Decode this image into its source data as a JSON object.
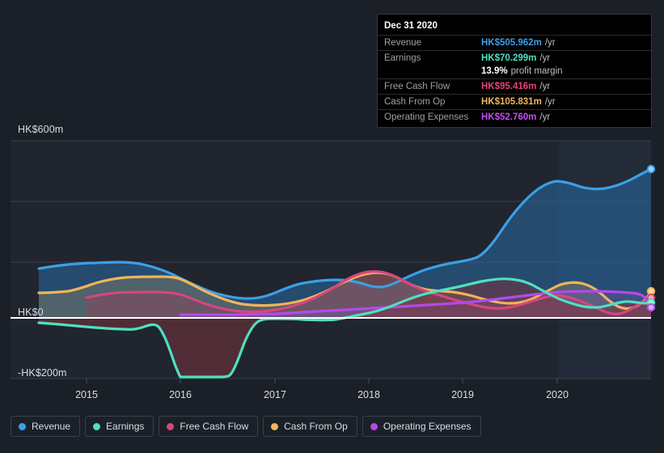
{
  "tooltip": {
    "title": "Dec 31 2020",
    "rows": [
      {
        "label": "Revenue",
        "value": "HK$505.962m",
        "unit": "/yr",
        "color": "#3b9fe8"
      },
      {
        "label": "Earnings",
        "value": "HK$70.299m",
        "unit": "/yr",
        "color": "#4fe0c0"
      },
      {
        "label": "",
        "value": "13.9%",
        "unit": "profit margin",
        "color": "#ffffff"
      },
      {
        "label": "Free Cash Flow",
        "value": "HK$95.416m",
        "unit": "/yr",
        "color": "#e8417e"
      },
      {
        "label": "Cash From Op",
        "value": "HK$105.831m",
        "unit": "/yr",
        "color": "#f0b45a"
      },
      {
        "label": "Operating Expenses",
        "value": "HK$52.760m",
        "unit": "/yr",
        "color": "#c14ef0"
      }
    ]
  },
  "legend": {
    "items": [
      {
        "label": "Revenue",
        "color": "#3b9fe8"
      },
      {
        "label": "Earnings",
        "color": "#4fe0c0"
      },
      {
        "label": "Free Cash Flow",
        "color": "#d6467e"
      },
      {
        "label": "Cash From Op",
        "color": "#f0b45a"
      },
      {
        "label": "Operating Expenses",
        "color": "#b44ae8"
      }
    ]
  },
  "axes": {
    "y_labels": [
      {
        "text": "HK$600m"
      },
      {
        "text": "HK$0"
      },
      {
        "text": "-HK$200m"
      }
    ],
    "x_labels": [
      {
        "text": "2015"
      },
      {
        "text": "2016"
      },
      {
        "text": "2017"
      },
      {
        "text": "2018"
      },
      {
        "text": "2019"
      },
      {
        "text": "2020"
      }
    ]
  },
  "chart_data": {
    "type": "area",
    "title": "",
    "xlabel": "",
    "ylabel": "HK$m",
    "currency": "HK$",
    "unit": "m",
    "ylim": [
      -260,
      600
    ],
    "yticks": [
      600,
      0,
      -200
    ],
    "ytick_labels": [
      "HK$600m",
      "HK$0",
      "-HK$200m"
    ],
    "grid": true,
    "gridlines_y": [
      600,
      400,
      200,
      0,
      -200
    ],
    "zero_line": 0,
    "legend_position": "bottom-left",
    "x": [
      "2014.7",
      "2015.0",
      "2015.25",
      "2015.5",
      "2015.75",
      "2016.0",
      "2016.25",
      "2016.5",
      "2016.75",
      "2017.0",
      "2017.25",
      "2017.5",
      "2017.75",
      "2018.0",
      "2018.25",
      "2018.5",
      "2018.75",
      "2019.0",
      "2019.25",
      "2019.5",
      "2019.75",
      "2020.0",
      "2020.25",
      "2020.5",
      "2020.75",
      "2021.0"
    ],
    "xtick_values": [
      "2015",
      "2016",
      "2017",
      "2018",
      "2019",
      "2020"
    ],
    "series": [
      {
        "name": "Revenue",
        "color": "#3b9fe8",
        "fill": "rgba(41,103,160,0.55)",
        "last_value": 505.962,
        "last_label": "HK$505.962m",
        "values": [
          163,
          172,
          176,
          178,
          170,
          158,
          140,
          126,
          116,
          107,
          104,
          104,
          112,
          124,
          140,
          152,
          162,
          170,
          178,
          186,
          200,
          250,
          320,
          368,
          378,
          404,
          506
        ]
      },
      {
        "name": "Earnings",
        "color": "#4fe0c0",
        "fill": "rgba(79,224,192,0.18)",
        "last_value": 70.299,
        "last_label": "HK$70.299m",
        "values": [
          -16,
          -20,
          -22,
          -24,
          -60,
          -140,
          -196,
          -196,
          -196,
          -150,
          -40,
          -14,
          -12,
          -8,
          2,
          12,
          24,
          34,
          46,
          62,
          80,
          96,
          92,
          70,
          40,
          46,
          70
        ]
      },
      {
        "name": "Free Cash Flow",
        "color": "#d6467e",
        "fill": "rgba(150,60,90,0.40)",
        "start_x": "2015.0",
        "last_value": 95.416,
        "last_label": "HK$95.416m",
        "values": [
          null,
          58,
          66,
          70,
          70,
          70,
          62,
          48,
          34,
          26,
          24,
          30,
          44,
          60,
          82,
          104,
          116,
          110,
          92,
          72,
          56,
          68,
          88,
          72,
          44,
          60,
          95
        ]
      },
      {
        "name": "Cash From Op",
        "color": "#f0b45a",
        "fill": "rgba(140,130,96,0.38)",
        "last_value": 105.831,
        "last_label": "HK$105.831m",
        "values": [
          82,
          82,
          86,
          100,
          110,
          112,
          112,
          104,
          82,
          66,
          62,
          62,
          68,
          78,
          92,
          112,
          126,
          120,
          108,
          94,
          78,
          68,
          82,
          98,
          76,
          56,
          106
        ]
      },
      {
        "name": "Operating Expenses",
        "color": "#b44ae8",
        "fill": "rgba(120,80,180,0.30)",
        "start_x": "2016.0",
        "last_value": 52.76,
        "last_label": "HK$52.760m",
        "values": [
          null,
          null,
          null,
          null,
          null,
          8,
          8,
          8,
          10,
          12,
          14,
          16,
          18,
          20,
          22,
          24,
          26,
          28,
          30,
          34,
          38,
          44,
          48,
          52,
          54,
          52,
          53
        ]
      }
    ]
  }
}
